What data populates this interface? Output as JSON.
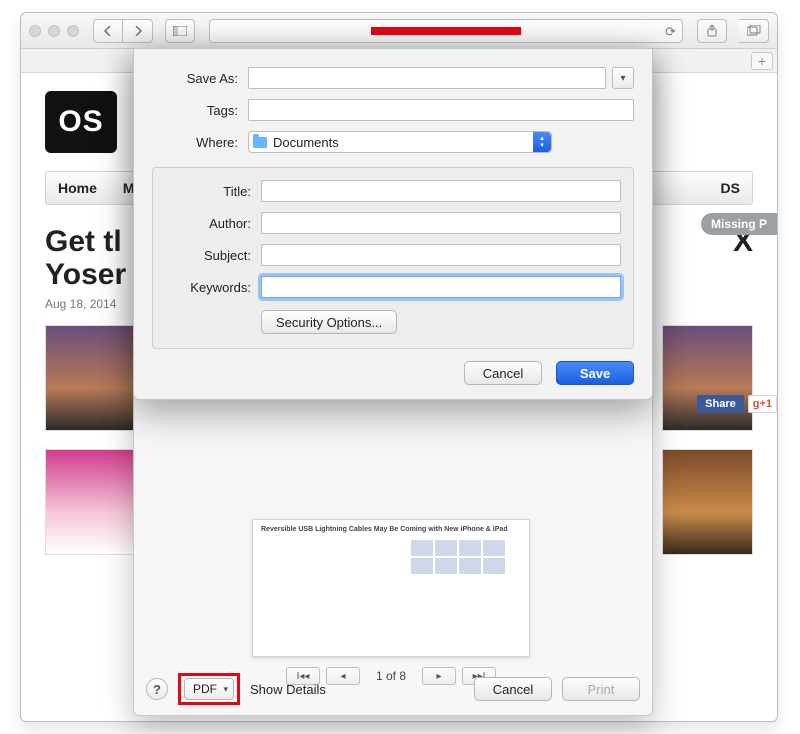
{
  "toolbar": {
    "share_icon": "share-icon",
    "tabs_icon": "tabs-icon",
    "sidebar_icon": "sidebar-icon"
  },
  "page": {
    "logo": "OS",
    "nav": {
      "home": "Home",
      "m": "M",
      "ds_suffix": "DS"
    },
    "headline_1": "Get tl",
    "headline_2": "X",
    "headline_3": "Yoser",
    "date": "Aug 18, 2014",
    "missing": "Missing P",
    "share": "Share",
    "gplus": "+1"
  },
  "save_dialog": {
    "save_as_label": "Save As:",
    "tags_label": "Tags:",
    "where_label": "Where:",
    "where_value": "Documents",
    "title_label": "Title:",
    "author_label": "Author:",
    "subject_label": "Subject:",
    "keywords_label": "Keywords:",
    "security_btn": "Security Options...",
    "cancel": "Cancel",
    "save": "Save",
    "save_as_value": "",
    "tags_value": "",
    "title_value": "",
    "author_value": "",
    "subject_value": "",
    "keywords_value": ""
  },
  "print_sheet": {
    "preview_title": "Reversible USB Lightning Cables May Be Coming with New iPhone & iPad",
    "page_indicator": "1 of 8",
    "pdf_menu": "PDF",
    "show_details": "Show Details",
    "cancel": "Cancel",
    "print": "Print",
    "help": "?"
  }
}
